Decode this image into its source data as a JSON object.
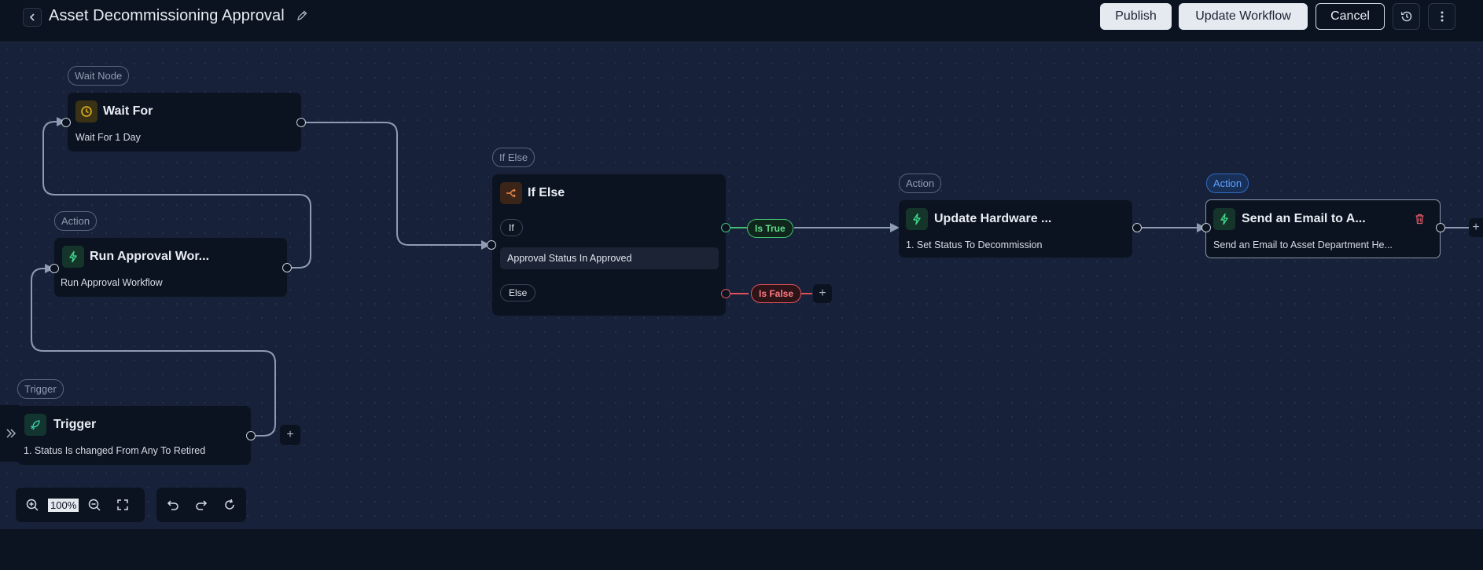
{
  "header": {
    "title": "Asset Decommissioning Approval",
    "publish_label": "Publish",
    "update_label": "Update Workflow",
    "cancel_label": "Cancel"
  },
  "colors": {
    "accent": "#5ea2ff",
    "true_green": "#3fbf6f",
    "false_red": "#e0505a",
    "wait_yellow": "#e8b923",
    "ifelse_orange": "#e8874a",
    "action_green": "#3fd68a",
    "trigger_teal": "#3fd6b0"
  },
  "nodes": {
    "wait": {
      "tag": "Wait Node",
      "title": "Wait For",
      "subtitle": "Wait For 1 Day",
      "icon": "clock-icon"
    },
    "run_approval": {
      "tag": "Action",
      "title": "Run Approval Wor...",
      "subtitle": "Run Approval Workflow",
      "icon": "bolt-icon"
    },
    "trigger": {
      "tag": "Trigger",
      "title": "Trigger",
      "subtitle": "1. Status Is changed From Any To Retired",
      "icon": "rocket-icon"
    },
    "if_else": {
      "tag": "If Else",
      "title": "If Else",
      "if_label": "If",
      "condition": "Approval Status In Approved",
      "else_label": "Else",
      "icon": "branch-icon"
    },
    "update_hardware": {
      "tag": "Action",
      "title": "Update Hardware ...",
      "subtitle": "1. Set Status To Decommission",
      "icon": "bolt-icon"
    },
    "send_email": {
      "tag": "Action",
      "title": "Send an Email to A...",
      "subtitle": "Send an Email to Asset Department He...",
      "icon": "bolt-icon"
    }
  },
  "branches": {
    "true_label": "Is True",
    "false_label": "Is False"
  },
  "controls": {
    "zoom": "100%"
  }
}
